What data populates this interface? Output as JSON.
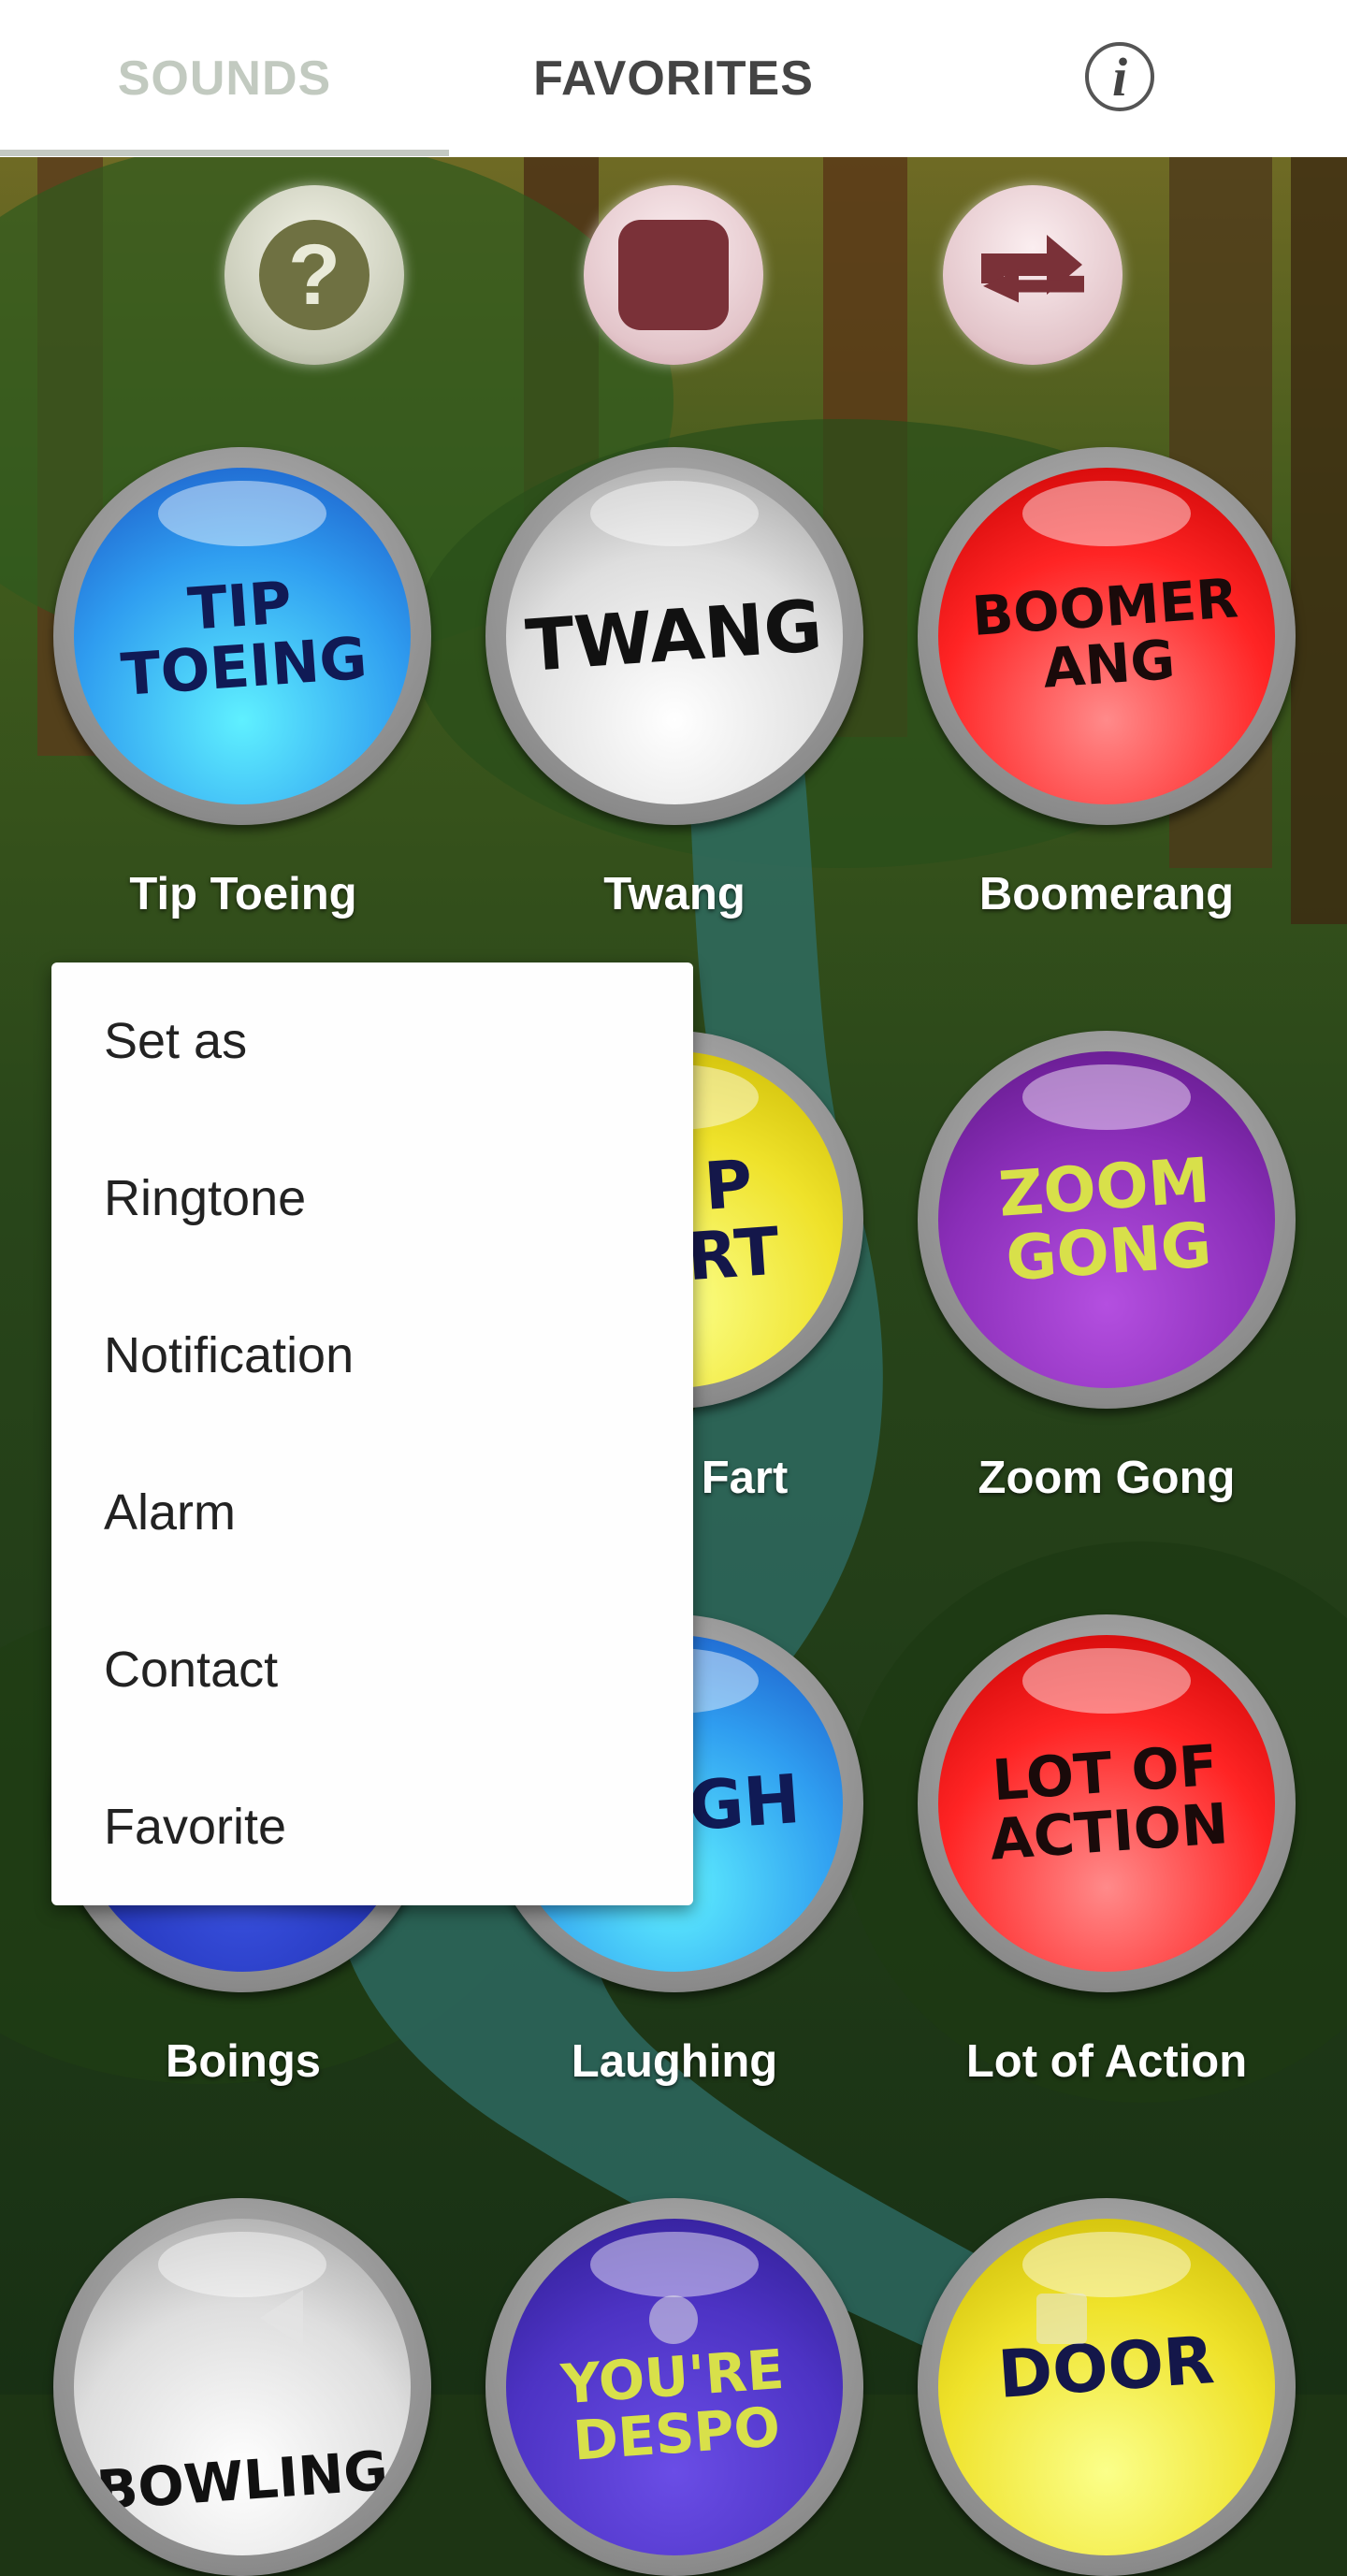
{
  "tabs": {
    "sounds": "SOUNDS",
    "favorites": "FAVORITES",
    "info_glyph": "i"
  },
  "controls": {
    "help_glyph": "?",
    "help_icon": "question-icon",
    "stop_icon": "stop-icon",
    "repeat_icon": "repeat-icon"
  },
  "sounds": {
    "tip_toeing": {
      "label": "Tip Toeing",
      "art": "TIP\nTOEING",
      "color": "#2f9df0"
    },
    "twang": {
      "label": "Twang",
      "art": "TWANG",
      "color": "#dedede"
    },
    "boomerang": {
      "label": "Boomerang",
      "art": "BOOMER\nANG",
      "color": "#ff2424"
    },
    "fart": {
      "label": "Fart",
      "art": "P\nRT",
      "color": "#efe22a"
    },
    "zoom_gong": {
      "label": "Zoom Gong",
      "art": "ZOOM\nGONG",
      "color": "#8a2eb8"
    },
    "boings": {
      "label": "Boings",
      "color": "#2233b8"
    },
    "laughing": {
      "label": "Laughing",
      "art": "GH",
      "color": "#2f9df0"
    },
    "lot_of_action": {
      "label": "Lot of Action",
      "art": "LOT OF\nACTION",
      "color": "#ff2424"
    },
    "bowling": {
      "art": "BOWLING",
      "color": "#dedede"
    },
    "youre_despo": {
      "art": "YOU'RE\nDESPO",
      "color": "#4d33c4"
    },
    "door": {
      "art": "DOOR",
      "color": "#efe22a"
    }
  },
  "menu": {
    "title": "Set as",
    "items": [
      "Ringtone",
      "Notification",
      "Alarm",
      "Contact",
      "Favorite"
    ]
  },
  "navbar": {
    "back_icon": "back-icon",
    "home_icon": "home-icon",
    "recents_icon": "recents-icon"
  }
}
